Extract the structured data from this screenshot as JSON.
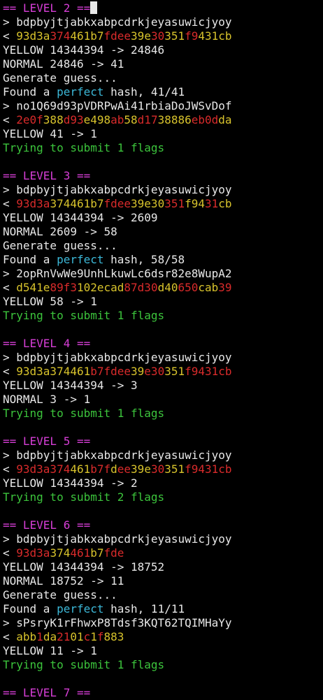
{
  "window": {
    "title": ""
  },
  "colors": {
    "background": "#000000",
    "default": "#e8e8e8",
    "magenta": "#d73ed7",
    "green": "#3cc43c",
    "red": "#d92b2b",
    "yellow": "#d8c32c",
    "cyan": "#3cb8d8",
    "cursor": "#e8e8e8"
  },
  "lines": [
    {
      "segments": [
        {
          "text": "== LEVEL 2 ==",
          "color": "magenta"
        }
      ],
      "cursor": true
    },
    {
      "segments": [
        {
          "text": "> bdpbyjtjabkxabpcdrkjeyasuwicjyoy",
          "color": "default"
        }
      ]
    },
    {
      "segments": [
        {
          "text": "< ",
          "color": "default"
        },
        {
          "text": "93d3a",
          "color": "yellow"
        },
        {
          "text": "374",
          "color": "red"
        },
        {
          "text": "461b7",
          "color": "yellow"
        },
        {
          "text": "fdee",
          "color": "red"
        },
        {
          "text": "39e",
          "color": "yellow"
        },
        {
          "text": "30",
          "color": "red"
        },
        {
          "text": "351",
          "color": "yellow"
        },
        {
          "text": "f9",
          "color": "red"
        },
        {
          "text": "431cb",
          "color": "yellow"
        }
      ]
    },
    {
      "segments": [
        {
          "text": "YELLOW 14344394 -> 24846",
          "color": "default"
        }
      ]
    },
    {
      "segments": [
        {
          "text": "NORMAL 24846 -> 41",
          "color": "default"
        }
      ]
    },
    {
      "segments": [
        {
          "text": "Generate guess...",
          "color": "default"
        }
      ]
    },
    {
      "segments": [
        {
          "text": "Found a ",
          "color": "default"
        },
        {
          "text": "perfect",
          "color": "cyan"
        },
        {
          "text": " hash, 41/41",
          "color": "default"
        }
      ]
    },
    {
      "segments": [
        {
          "text": "> no1Q69d93pVDRPwAi41rbiaDoJWSvDof",
          "color": "default"
        }
      ]
    },
    {
      "segments": [
        {
          "text": "< ",
          "color": "default"
        },
        {
          "text": "2e0f",
          "color": "red"
        },
        {
          "text": "388",
          "color": "yellow"
        },
        {
          "text": "d93",
          "color": "red"
        },
        {
          "text": "e498",
          "color": "yellow"
        },
        {
          "text": "ab",
          "color": "red"
        },
        {
          "text": "58",
          "color": "yellow"
        },
        {
          "text": "d17",
          "color": "red"
        },
        {
          "text": "38886",
          "color": "yellow"
        },
        {
          "text": "eb0d",
          "color": "red"
        },
        {
          "text": "da",
          "color": "yellow"
        }
      ]
    },
    {
      "segments": [
        {
          "text": "YELLOW 41 -> 1",
          "color": "default"
        }
      ]
    },
    {
      "segments": [
        {
          "text": "Trying to submit 1 flags",
          "color": "green"
        }
      ]
    },
    {
      "segments": []
    },
    {
      "segments": [
        {
          "text": "== LEVEL 3 ==",
          "color": "magenta"
        }
      ]
    },
    {
      "segments": [
        {
          "text": "> bdpbyjtjabkxabpcdrkjeyasuwicjyoy",
          "color": "default"
        }
      ]
    },
    {
      "segments": [
        {
          "text": "< ",
          "color": "default"
        },
        {
          "text": "93d3a",
          "color": "red"
        },
        {
          "text": "374461b7",
          "color": "yellow"
        },
        {
          "text": "fdee",
          "color": "red"
        },
        {
          "text": "39e30",
          "color": "yellow"
        },
        {
          "text": "351",
          "color": "red"
        },
        {
          "text": "f94",
          "color": "yellow"
        },
        {
          "text": "31",
          "color": "red"
        },
        {
          "text": "cb",
          "color": "yellow"
        }
      ]
    },
    {
      "segments": [
        {
          "text": "YELLOW 14344394 -> 2609",
          "color": "default"
        }
      ]
    },
    {
      "segments": [
        {
          "text": "NORMAL 2609 -> 58",
          "color": "default"
        }
      ]
    },
    {
      "segments": [
        {
          "text": "Generate guess...",
          "color": "default"
        }
      ]
    },
    {
      "segments": [
        {
          "text": "Found a ",
          "color": "default"
        },
        {
          "text": "perfect",
          "color": "cyan"
        },
        {
          "text": " hash, 58/58",
          "color": "default"
        }
      ]
    },
    {
      "segments": [
        {
          "text": "> 2opRnVwWe9UnhLkuwLc6dsr82e8WupA2",
          "color": "default"
        }
      ]
    },
    {
      "segments": [
        {
          "text": "< ",
          "color": "default"
        },
        {
          "text": "d541e",
          "color": "yellow"
        },
        {
          "text": "89f3",
          "color": "red"
        },
        {
          "text": "102ecad",
          "color": "yellow"
        },
        {
          "text": "87d30",
          "color": "red"
        },
        {
          "text": "d40",
          "color": "yellow"
        },
        {
          "text": "650",
          "color": "red"
        },
        {
          "text": "cab",
          "color": "yellow"
        },
        {
          "text": "39",
          "color": "red"
        }
      ]
    },
    {
      "segments": [
        {
          "text": "YELLOW 58 -> 1",
          "color": "default"
        }
      ]
    },
    {
      "segments": [
        {
          "text": "Trying to submit 1 flags",
          "color": "green"
        }
      ]
    },
    {
      "segments": []
    },
    {
      "segments": [
        {
          "text": "== LEVEL 4 ==",
          "color": "magenta"
        }
      ]
    },
    {
      "segments": [
        {
          "text": "> bdpbyjtjabkxabpcdrkjeyasuwicjyoy",
          "color": "default"
        }
      ]
    },
    {
      "segments": [
        {
          "text": "< ",
          "color": "default"
        },
        {
          "text": "93d3a374461",
          "color": "yellow"
        },
        {
          "text": "b7fdee",
          "color": "red"
        },
        {
          "text": "39",
          "color": "yellow"
        },
        {
          "text": "e30",
          "color": "red"
        },
        {
          "text": "351",
          "color": "yellow"
        },
        {
          "text": "f9431cb",
          "color": "red"
        }
      ]
    },
    {
      "segments": [
        {
          "text": "YELLOW 14344394 -> 3",
          "color": "default"
        }
      ]
    },
    {
      "segments": [
        {
          "text": "NORMAL 3 -> 1",
          "color": "default"
        }
      ]
    },
    {
      "segments": [
        {
          "text": "Trying to submit 1 flags",
          "color": "green"
        }
      ]
    },
    {
      "segments": []
    },
    {
      "segments": [
        {
          "text": "== LEVEL 5 ==",
          "color": "magenta"
        }
      ]
    },
    {
      "segments": [
        {
          "text": "> bdpbyjtjabkxabpcdrkjeyasuwicjyoy",
          "color": "default"
        }
      ]
    },
    {
      "segments": [
        {
          "text": "< ",
          "color": "default"
        },
        {
          "text": "93d3a374",
          "color": "red"
        },
        {
          "text": "461",
          "color": "yellow"
        },
        {
          "text": "b7f",
          "color": "red"
        },
        {
          "text": "d",
          "color": "yellow"
        },
        {
          "text": "ee",
          "color": "red"
        },
        {
          "text": "39e",
          "color": "yellow"
        },
        {
          "text": "30",
          "color": "red"
        },
        {
          "text": "351",
          "color": "yellow"
        },
        {
          "text": "f9431cb",
          "color": "red"
        }
      ]
    },
    {
      "segments": [
        {
          "text": "YELLOW 14344394 -> 2",
          "color": "default"
        }
      ]
    },
    {
      "segments": [
        {
          "text": "Trying to submit 2 flags",
          "color": "green"
        }
      ]
    },
    {
      "segments": []
    },
    {
      "segments": [
        {
          "text": "== LEVEL 6 ==",
          "color": "magenta"
        }
      ]
    },
    {
      "segments": [
        {
          "text": "> bdpbyjtjabkxabpcdrkjeyasuwicjyoy",
          "color": "default"
        }
      ]
    },
    {
      "segments": [
        {
          "text": "< ",
          "color": "default"
        },
        {
          "text": "93d3a",
          "color": "red"
        },
        {
          "text": "374",
          "color": "yellow"
        },
        {
          "text": "461",
          "color": "red"
        },
        {
          "text": "b7",
          "color": "yellow"
        },
        {
          "text": "fde",
          "color": "red"
        }
      ]
    },
    {
      "segments": [
        {
          "text": "YELLOW 14344394 -> 18752",
          "color": "default"
        }
      ]
    },
    {
      "segments": [
        {
          "text": "NORMAL 18752 -> 11",
          "color": "default"
        }
      ]
    },
    {
      "segments": [
        {
          "text": "Generate guess...",
          "color": "default"
        }
      ]
    },
    {
      "segments": [
        {
          "text": "Found a ",
          "color": "default"
        },
        {
          "text": "perfect",
          "color": "cyan"
        },
        {
          "text": " hash, 11/11",
          "color": "default"
        }
      ]
    },
    {
      "segments": [
        {
          "text": "> sPsryK1rFhwxP8Tdsf3KQT62TQIMHaYy",
          "color": "default"
        }
      ]
    },
    {
      "segments": [
        {
          "text": "< ",
          "color": "default"
        },
        {
          "text": "abb",
          "color": "yellow"
        },
        {
          "text": "1",
          "color": "red"
        },
        {
          "text": "da",
          "color": "yellow"
        },
        {
          "text": "21",
          "color": "red"
        },
        {
          "text": "01",
          "color": "yellow"
        },
        {
          "text": "c",
          "color": "red"
        },
        {
          "text": "1",
          "color": "yellow"
        },
        {
          "text": "f",
          "color": "red"
        },
        {
          "text": "883",
          "color": "yellow"
        }
      ]
    },
    {
      "segments": [
        {
          "text": "YELLOW 11 -> 1",
          "color": "default"
        }
      ]
    },
    {
      "segments": [
        {
          "text": "Trying to submit 1 flags",
          "color": "green"
        }
      ]
    },
    {
      "segments": []
    },
    {
      "segments": [
        {
          "text": "== LEVEL 7 ==",
          "color": "magenta"
        }
      ]
    }
  ]
}
